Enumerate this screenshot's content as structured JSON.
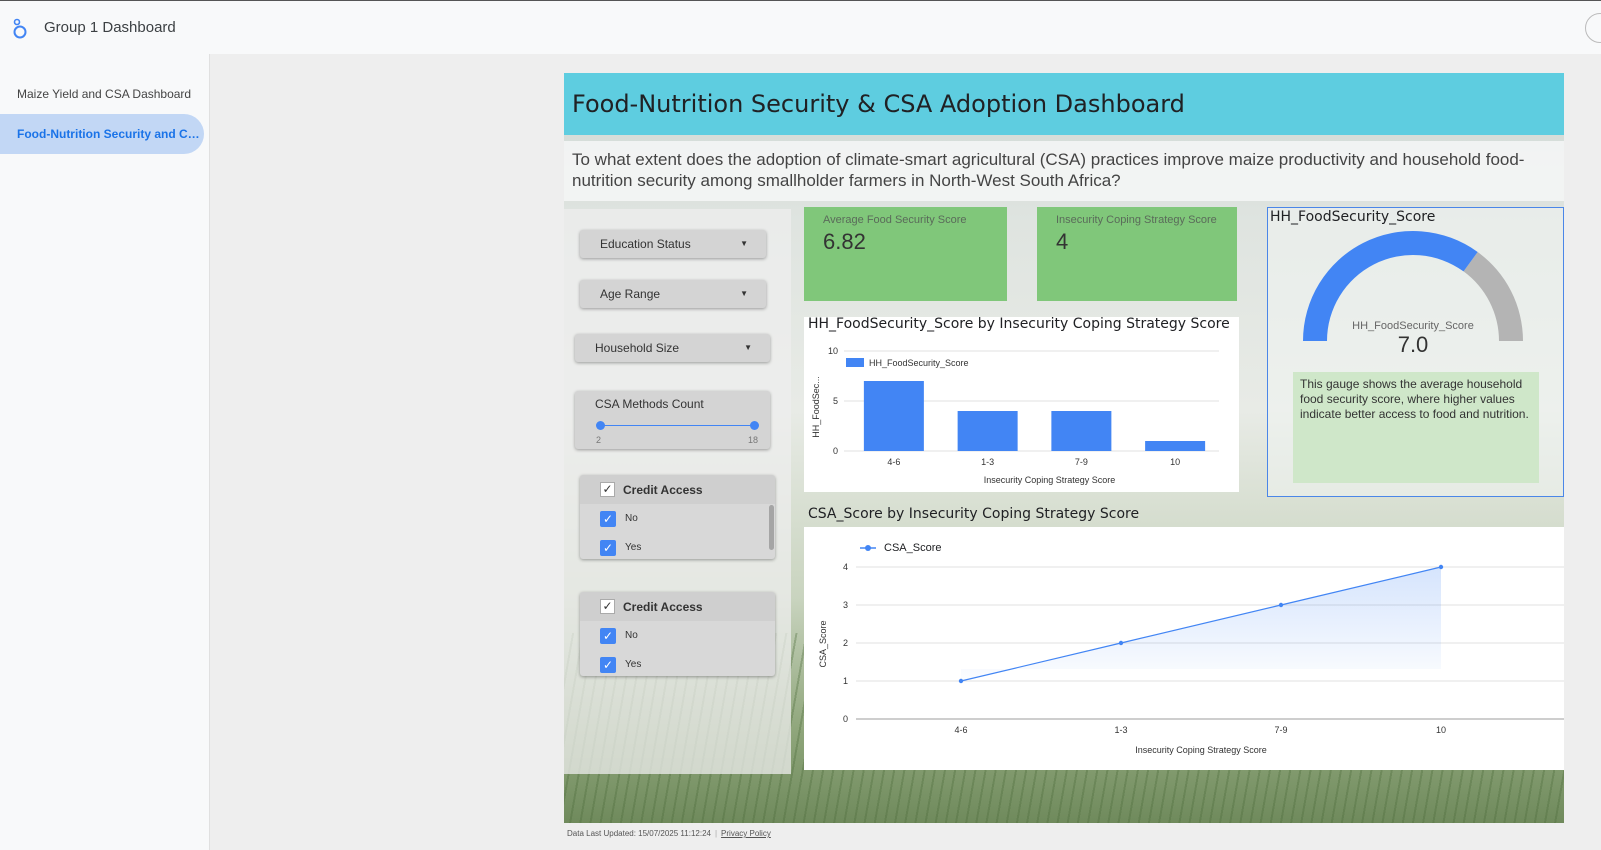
{
  "app": {
    "title": "Group 1 Dashboard"
  },
  "nav": {
    "items": [
      {
        "label": "Maize Yield and CSA Dashboard"
      },
      {
        "label": "Food-Nutrition Security and CSA Adoption Dashboard"
      }
    ]
  },
  "report": {
    "title": "Food-Nutrition Security & CSA Adoption Dashboard",
    "question": "To what extent does the adoption of climate-smart agricultural (CSA) practices improve maize productivity and household food-nutrition security among smallholder farmers in North-West South Africa?"
  },
  "filters": {
    "education": "Education Status",
    "age": "Age Range",
    "household": "Household Size",
    "csa_count": {
      "label": "CSA Methods Count",
      "min": "2",
      "max": "18"
    },
    "credit1": {
      "title": "Credit Access",
      "options": [
        "No",
        "Yes"
      ]
    },
    "credit2": {
      "title": "Credit Access",
      "options": [
        "No",
        "Yes"
      ]
    }
  },
  "kpis": {
    "avg_food": {
      "label": "Average Food Security Score",
      "value": "6.82"
    },
    "coping": {
      "label": "Insecurity Coping Strategy Score",
      "value": "4"
    }
  },
  "gauge": {
    "title": "HH_FoodSecurity_Score",
    "label": "HH_FoodSecurity_Score",
    "value_text": "7.0",
    "value": 7.0,
    "max": 10,
    "note": "This gauge shows the average household food security score, where higher values indicate better access to food and nutrition."
  },
  "footer": {
    "updated": "Data Last Updated: 15/07/2025 11:12:24",
    "privacy": "Privacy Policy"
  },
  "colors": {
    "accent": "#4285f4",
    "header": "#5ecde0",
    "kpi": "#80c77a",
    "note": "#cfe7c9",
    "gauge_rest": "#b4b4b4"
  },
  "chart_data": [
    {
      "type": "bar",
      "title": "HH_FoodSecurity_Score by Insecurity Coping Strategy Score",
      "categories": [
        "4-6",
        "1-3",
        "7-9",
        "10"
      ],
      "series": [
        {
          "name": "HH_FoodSecurity_Score",
          "values": [
            7,
            4,
            4,
            1
          ]
        }
      ],
      "xlabel": "Insecurity Coping Strategy Score",
      "ylabel": "HH_FoodSec...",
      "ylim": [
        0,
        10
      ],
      "yticks": [
        "0",
        "5",
        "10"
      ],
      "legend": "top-left",
      "grid": true
    },
    {
      "type": "line",
      "title": "CSA_Score by Insecurity Coping Strategy Score",
      "categories": [
        "4-6",
        "1-3",
        "7-9",
        "10"
      ],
      "series": [
        {
          "name": "CSA_Score",
          "values": [
            1,
            2,
            3,
            4
          ]
        }
      ],
      "xlabel": "Insecurity Coping Strategy Score",
      "ylabel": "CSA_Score",
      "ylim": [
        0,
        4
      ],
      "yticks": [
        "0",
        "1",
        "2",
        "3",
        "4"
      ],
      "legend": "top-left",
      "grid": true
    }
  ]
}
